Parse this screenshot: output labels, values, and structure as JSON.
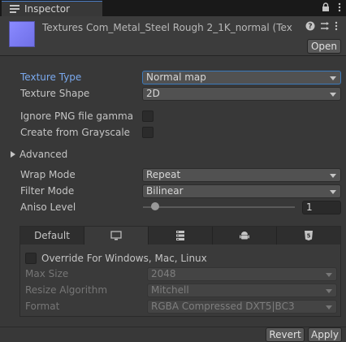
{
  "window": {
    "tab_title": "Inspector",
    "tab_icons": [
      "lock-icon",
      "kebab-menu-icon"
    ]
  },
  "header": {
    "asset_title": "Textures Com_Metal_Steel Rough 2_1K_normal (Tex",
    "icons": [
      "help-icon",
      "preset-icon",
      "kebab-menu-icon"
    ],
    "open_label": "Open"
  },
  "importer": {
    "texture_type": {
      "label": "Texture Type",
      "value": "Normal map"
    },
    "texture_shape": {
      "label": "Texture Shape",
      "value": "2D"
    },
    "ignore_png_gamma": {
      "label": "Ignore PNG file gamma",
      "checked": false
    },
    "create_from_grayscale": {
      "label": "Create from Grayscale",
      "checked": false
    },
    "advanced": {
      "label": "Advanced",
      "expanded": false
    },
    "wrap_mode": {
      "label": "Wrap Mode",
      "value": "Repeat"
    },
    "filter_mode": {
      "label": "Filter Mode",
      "value": "Bilinear"
    },
    "aniso_level": {
      "label": "Aniso Level",
      "value": "1"
    }
  },
  "platform_settings": {
    "tabs": [
      {
        "label": "Default",
        "icon": null
      },
      {
        "label": "",
        "icon": "monitor-icon"
      },
      {
        "label": "",
        "icon": "server-icon"
      },
      {
        "label": "",
        "icon": "android-icon"
      },
      {
        "label": "",
        "icon": "html5-icon"
      }
    ],
    "override_label": "Override For Windows, Mac, Linux",
    "override_checked": false,
    "max_size": {
      "label": "Max Size",
      "value": "2048"
    },
    "resize_algorithm": {
      "label": "Resize Algorithm",
      "value": "Mitchell"
    },
    "format": {
      "label": "Format",
      "value": "RGBA Compressed DXT5|BC3"
    }
  },
  "footer": {
    "revert_label": "Revert",
    "apply_label": "Apply"
  },
  "colors": {
    "accent": "#4d7fc9",
    "label_highlight": "#7aa9ee",
    "background": "#383838"
  }
}
